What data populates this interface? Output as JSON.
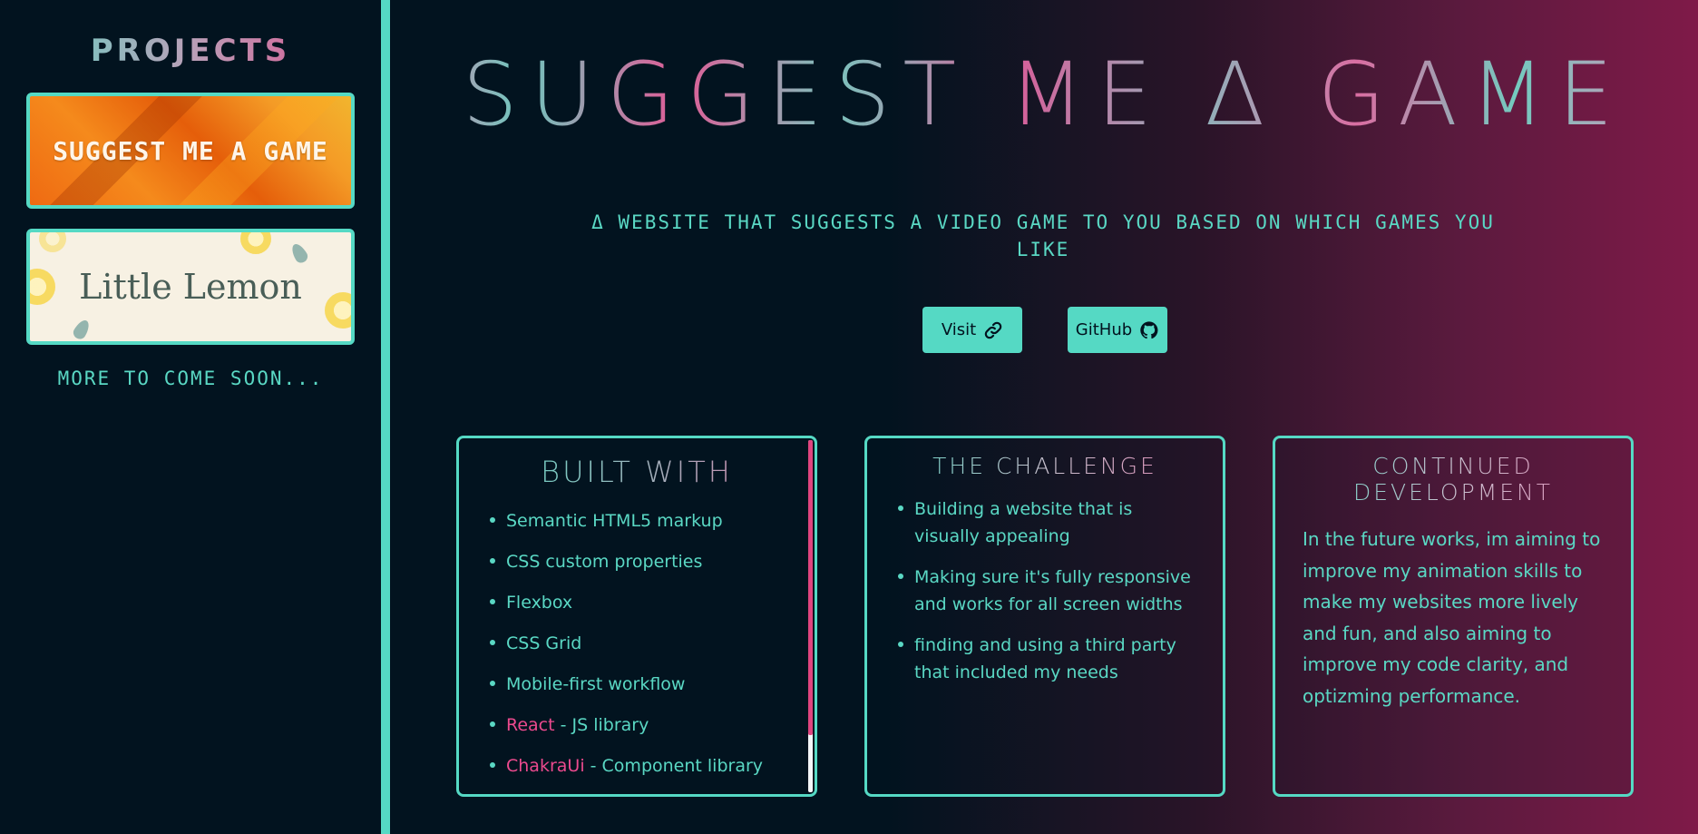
{
  "sidebar": {
    "title": "PROJECTS",
    "projects": [
      {
        "label": "SUGGEST ME A GAME"
      },
      {
        "label": "Little Lemon"
      }
    ],
    "more_text": "MORE TO COME SOON..."
  },
  "hero": {
    "title": "SUGGEST ME Δ GAME",
    "subtitle": "Δ WEBSITE THAT SUGGESTS A VIDEO GAME TO YOU BASED ON WHICH GAMES YOU LIKE"
  },
  "buttons": {
    "visit": {
      "label": "Visit",
      "icon": "link-icon"
    },
    "github": {
      "label": "GitHub",
      "icon": "github-icon"
    }
  },
  "built_with": {
    "heading": "BUILT WITH",
    "items": [
      {
        "text": "Semantic HTML5 markup"
      },
      {
        "text": "CSS custom properties"
      },
      {
        "text": "Flexbox"
      },
      {
        "text": "CSS Grid"
      },
      {
        "text": "Mobile-first workflow"
      },
      {
        "highlight": "React",
        "text": " - JS library"
      },
      {
        "highlight": "ChakraUi",
        "text": " - Component library"
      }
    ]
  },
  "challenge": {
    "heading": "THE CHALLENGE",
    "items": [
      "Building a website that is visually appealing",
      "Making sure it's fully responsive and works for all screen widths",
      "finding and using a third party that included my needs"
    ]
  },
  "development": {
    "heading": "CONTINUED DEVELOPMENT",
    "text": "In the future works, im aiming to improve my animation skills to make my websites more lively and fun, and also aiming to improve my code clarity, and optizming performance."
  },
  "colors": {
    "accent": "#55d9c4",
    "highlight": "#ec4a8e",
    "background": "#02131f",
    "gradient_end": "#7f1a48"
  }
}
